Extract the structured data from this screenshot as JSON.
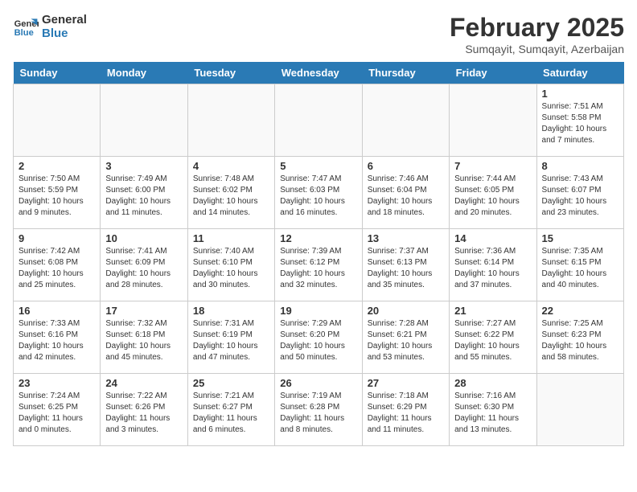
{
  "header": {
    "logo_general": "General",
    "logo_blue": "Blue",
    "month": "February 2025",
    "location": "Sumqayit, Sumqayit, Azerbaijan"
  },
  "days_of_week": [
    "Sunday",
    "Monday",
    "Tuesday",
    "Wednesday",
    "Thursday",
    "Friday",
    "Saturday"
  ],
  "weeks": [
    [
      {
        "day": "",
        "info": ""
      },
      {
        "day": "",
        "info": ""
      },
      {
        "day": "",
        "info": ""
      },
      {
        "day": "",
        "info": ""
      },
      {
        "day": "",
        "info": ""
      },
      {
        "day": "",
        "info": ""
      },
      {
        "day": "1",
        "info": "Sunrise: 7:51 AM\nSunset: 5:58 PM\nDaylight: 10 hours and 7 minutes."
      }
    ],
    [
      {
        "day": "2",
        "info": "Sunrise: 7:50 AM\nSunset: 5:59 PM\nDaylight: 10 hours and 9 minutes."
      },
      {
        "day": "3",
        "info": "Sunrise: 7:49 AM\nSunset: 6:00 PM\nDaylight: 10 hours and 11 minutes."
      },
      {
        "day": "4",
        "info": "Sunrise: 7:48 AM\nSunset: 6:02 PM\nDaylight: 10 hours and 14 minutes."
      },
      {
        "day": "5",
        "info": "Sunrise: 7:47 AM\nSunset: 6:03 PM\nDaylight: 10 hours and 16 minutes."
      },
      {
        "day": "6",
        "info": "Sunrise: 7:46 AM\nSunset: 6:04 PM\nDaylight: 10 hours and 18 minutes."
      },
      {
        "day": "7",
        "info": "Sunrise: 7:44 AM\nSunset: 6:05 PM\nDaylight: 10 hours and 20 minutes."
      },
      {
        "day": "8",
        "info": "Sunrise: 7:43 AM\nSunset: 6:07 PM\nDaylight: 10 hours and 23 minutes."
      }
    ],
    [
      {
        "day": "9",
        "info": "Sunrise: 7:42 AM\nSunset: 6:08 PM\nDaylight: 10 hours and 25 minutes."
      },
      {
        "day": "10",
        "info": "Sunrise: 7:41 AM\nSunset: 6:09 PM\nDaylight: 10 hours and 28 minutes."
      },
      {
        "day": "11",
        "info": "Sunrise: 7:40 AM\nSunset: 6:10 PM\nDaylight: 10 hours and 30 minutes."
      },
      {
        "day": "12",
        "info": "Sunrise: 7:39 AM\nSunset: 6:12 PM\nDaylight: 10 hours and 32 minutes."
      },
      {
        "day": "13",
        "info": "Sunrise: 7:37 AM\nSunset: 6:13 PM\nDaylight: 10 hours and 35 minutes."
      },
      {
        "day": "14",
        "info": "Sunrise: 7:36 AM\nSunset: 6:14 PM\nDaylight: 10 hours and 37 minutes."
      },
      {
        "day": "15",
        "info": "Sunrise: 7:35 AM\nSunset: 6:15 PM\nDaylight: 10 hours and 40 minutes."
      }
    ],
    [
      {
        "day": "16",
        "info": "Sunrise: 7:33 AM\nSunset: 6:16 PM\nDaylight: 10 hours and 42 minutes."
      },
      {
        "day": "17",
        "info": "Sunrise: 7:32 AM\nSunset: 6:18 PM\nDaylight: 10 hours and 45 minutes."
      },
      {
        "day": "18",
        "info": "Sunrise: 7:31 AM\nSunset: 6:19 PM\nDaylight: 10 hours and 47 minutes."
      },
      {
        "day": "19",
        "info": "Sunrise: 7:29 AM\nSunset: 6:20 PM\nDaylight: 10 hours and 50 minutes."
      },
      {
        "day": "20",
        "info": "Sunrise: 7:28 AM\nSunset: 6:21 PM\nDaylight: 10 hours and 53 minutes."
      },
      {
        "day": "21",
        "info": "Sunrise: 7:27 AM\nSunset: 6:22 PM\nDaylight: 10 hours and 55 minutes."
      },
      {
        "day": "22",
        "info": "Sunrise: 7:25 AM\nSunset: 6:23 PM\nDaylight: 10 hours and 58 minutes."
      }
    ],
    [
      {
        "day": "23",
        "info": "Sunrise: 7:24 AM\nSunset: 6:25 PM\nDaylight: 11 hours and 0 minutes."
      },
      {
        "day": "24",
        "info": "Sunrise: 7:22 AM\nSunset: 6:26 PM\nDaylight: 11 hours and 3 minutes."
      },
      {
        "day": "25",
        "info": "Sunrise: 7:21 AM\nSunset: 6:27 PM\nDaylight: 11 hours and 6 minutes."
      },
      {
        "day": "26",
        "info": "Sunrise: 7:19 AM\nSunset: 6:28 PM\nDaylight: 11 hours and 8 minutes."
      },
      {
        "day": "27",
        "info": "Sunrise: 7:18 AM\nSunset: 6:29 PM\nDaylight: 11 hours and 11 minutes."
      },
      {
        "day": "28",
        "info": "Sunrise: 7:16 AM\nSunset: 6:30 PM\nDaylight: 11 hours and 13 minutes."
      },
      {
        "day": "",
        "info": ""
      }
    ]
  ]
}
